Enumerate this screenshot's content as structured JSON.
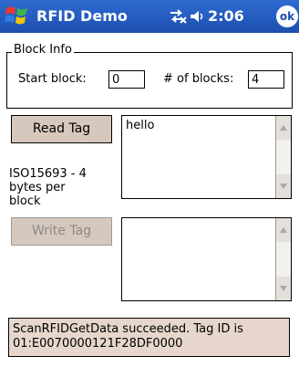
{
  "titlebar": {
    "title": "RFID Demo",
    "time": "2:06",
    "ok": "ok"
  },
  "block_info": {
    "legend": "Block Info",
    "start_label": "Start block:",
    "start_value": "0",
    "count_label": "# of blocks:",
    "count_value": "4"
  },
  "read": {
    "button": "Read Tag",
    "info": [
      "ISO15693 - 4",
      "bytes per",
      "block"
    ],
    "text": "hello"
  },
  "write": {
    "button": "Write Tag",
    "text": ""
  },
  "status": {
    "line1": "ScanRFIDGetData succeeded. Tag ID is",
    "line2": "01:E0070000121F28DF0000"
  },
  "colors": {
    "titlebar": "#1c4fb0",
    "button": "#d7c8bd",
    "statusbar": "#e6d6cc"
  }
}
